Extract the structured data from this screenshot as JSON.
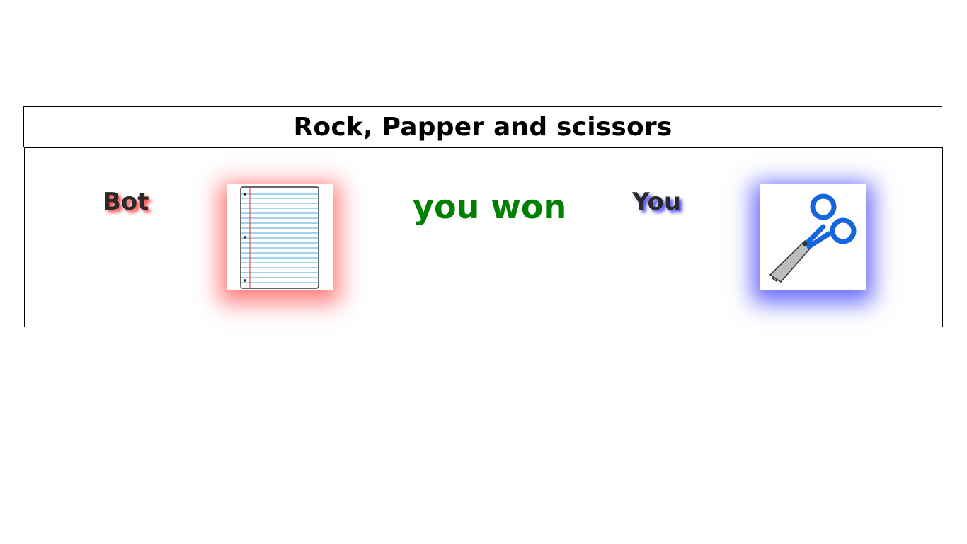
{
  "title": "Rock, Papper and scissors",
  "bot": {
    "label": "Bot",
    "choice": "paper",
    "choice_icon": "paper-icon",
    "glow_color": "#ff4a4a"
  },
  "you": {
    "label": "You",
    "choice": "scissors",
    "choice_icon": "scissors-icon",
    "glow_color": "#4a4aff"
  },
  "result": {
    "text": "you won",
    "color": "#008000"
  }
}
